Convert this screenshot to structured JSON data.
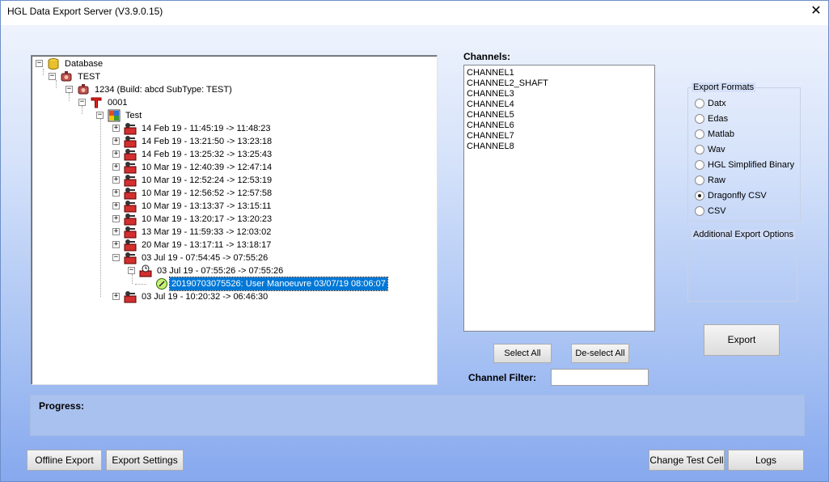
{
  "window": {
    "title": "HGL Data Export Server (V3.9.0.15)",
    "close_glyph": "✕"
  },
  "tree": {
    "database": "Database",
    "site": "TEST",
    "build": "1234 (Build: abcd  SubType: TEST)",
    "unit": "0001",
    "test": "Test",
    "sessions": [
      "14 Feb 19 - 11:45:19 -> 11:48:23",
      "14 Feb 19 - 13:21:50 -> 13:23:18",
      "14 Feb 19 - 13:25:32 -> 13:25:43",
      "10 Mar 19 - 12:40:39 -> 12:47:14",
      "10 Mar 19 - 12:52:24 -> 12:53:19",
      "10 Mar 19 - 12:56:52 -> 12:57:58",
      "10 Mar 19 - 13:13:37 -> 13:15:11",
      "10 Mar 19 - 13:20:17 -> 13:20:23",
      "13 Mar 19 - 11:59:33 -> 12:03:02",
      "20 Mar 19 - 13:17:11 -> 13:18:17",
      "03 Jul 19 - 07:54:45 -> 07:55:26"
    ],
    "sub_session": "03 Jul 19 - 07:55:26 -> 07:55:26",
    "event": "20190703075526: User Manoeuvre 03/07/19 08:06:07",
    "last_session": "03 Jul 19 - 10:20:32 -> 06:46:30",
    "expand_plus": "+",
    "expand_minus": "−"
  },
  "channels": {
    "title": "Channels:",
    "items": [
      "CHANNEL1",
      "CHANNEL2_SHAFT",
      "CHANNEL3",
      "CHANNEL4",
      "CHANNEL5",
      "CHANNEL6",
      "CHANNEL7",
      "CHANNEL8"
    ],
    "select_all": "Select All",
    "deselect_all": "De-select All",
    "filter_label": "Channel Filter:",
    "filter_value": ""
  },
  "export_formats": {
    "title": "Export Formats",
    "options": [
      "Datx",
      "Edas",
      "Matlab",
      "Wav",
      "HGL Simplified Binary",
      "Raw",
      "Dragonfly CSV",
      "CSV"
    ],
    "selected": "Dragonfly CSV"
  },
  "additional_options": {
    "title": "Additional Export Options"
  },
  "export_button": "Export",
  "progress": {
    "label": "Progress:"
  },
  "footer": {
    "offline_export": "Offline Export",
    "export_settings": "Export Settings",
    "change_test_cell": "Change Test Cell",
    "logs": "Logs"
  }
}
